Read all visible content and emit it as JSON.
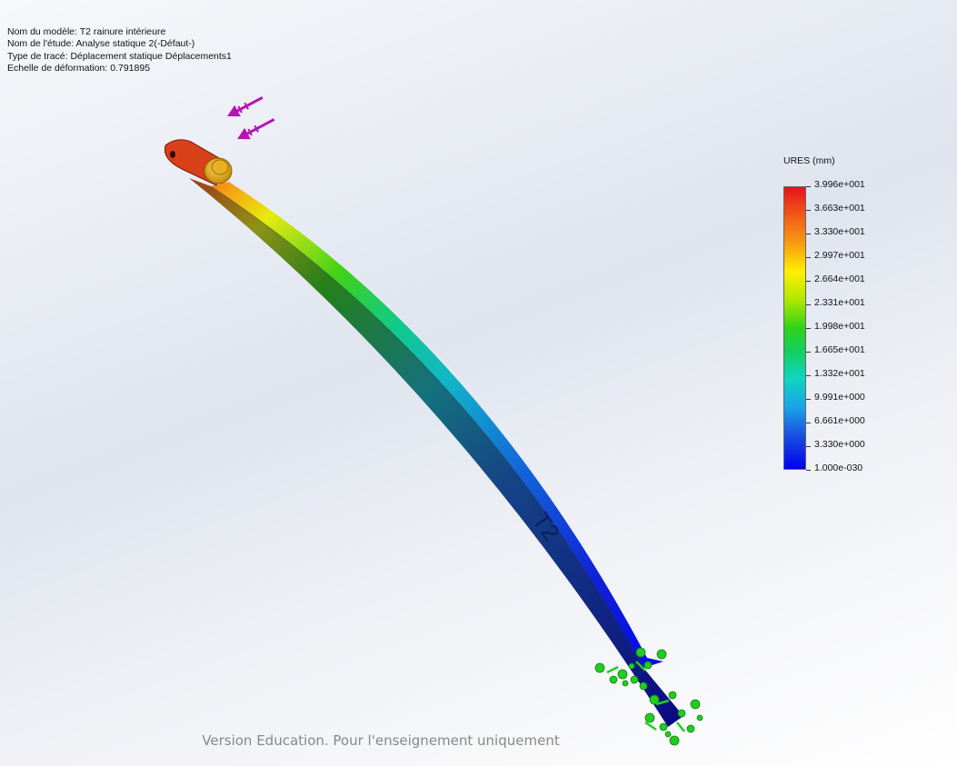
{
  "info": {
    "model_name": "Nom du modèle: T2 rainure intérieure",
    "study_name": "Nom de l'étude: Analyse statique 2(-Défaut-)",
    "plot_type": "Type de tracé: Déplacement statique Déplacements1",
    "deformation_scale": "Echelle de déformation: 0.791895"
  },
  "legend": {
    "title": "URES (mm)",
    "values": [
      "3.996e+001",
      "3.663e+001",
      "3.330e+001",
      "2.997e+001",
      "2.664e+001",
      "2.331e+001",
      "1.998e+001",
      "1.665e+001",
      "1.332e+001",
      "9.991e+000",
      "6.661e+000",
      "3.330e+000",
      "1.000e-030"
    ]
  },
  "part_engraving": "T2",
  "watermark": "Version Education. Pour l'enseignement uniquement",
  "colors": {
    "load_arrows": "#b414b4",
    "fixture_markers": "#22cc22",
    "max_displacement": "#e8121e",
    "min_displacement": "#0000f0"
  },
  "icons": [
    "force-arrow-icon",
    "fixture-icon"
  ]
}
